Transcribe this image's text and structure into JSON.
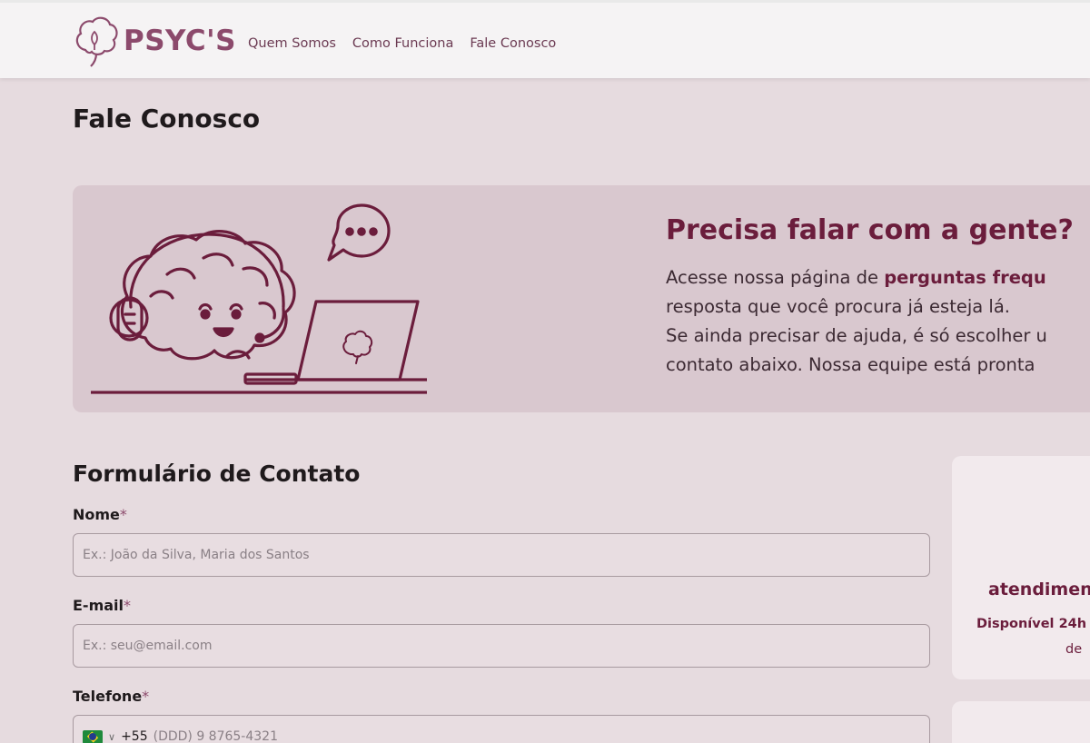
{
  "brand": {
    "name": "PSYC'S",
    "color": "#8c4a6c"
  },
  "nav": {
    "links": [
      {
        "label": "Quem Somos"
      },
      {
        "label": "Como Funciona"
      },
      {
        "label": "Fale Conosco"
      }
    ]
  },
  "page": {
    "title": "Fale Conosco"
  },
  "hero": {
    "title": "Precisa falar com a gente?",
    "line1_prefix": "Acesse nossa página de ",
    "line1_link": "perguntas frequ",
    "line2": "resposta que você procura já esteja lá.",
    "line3": "Se ainda precisar de ajuda, é só escolher u",
    "line4": "contato abaixo. Nossa equipe está pronta"
  },
  "form": {
    "title": "Formulário de Contato",
    "required_mark": "*",
    "fields": {
      "name": {
        "label": "Nome",
        "placeholder": "Ex.: João da Silva, Maria dos Santos"
      },
      "email": {
        "label": "E-mail",
        "placeholder": "Ex.: seu@email.com"
      },
      "phone": {
        "label": "Telefone",
        "country_code": "+55",
        "placeholder": "(DDD) 9 8765-4321",
        "flag_icon": "brazil-flag-icon"
      }
    }
  },
  "side_card": {
    "title": "atendimen",
    "line1": "Disponível 24h",
    "line2": "de"
  },
  "colors": {
    "accent": "#6b1d3c",
    "background": "#e6dbdf",
    "hero_bg": "#d9c8cf"
  }
}
